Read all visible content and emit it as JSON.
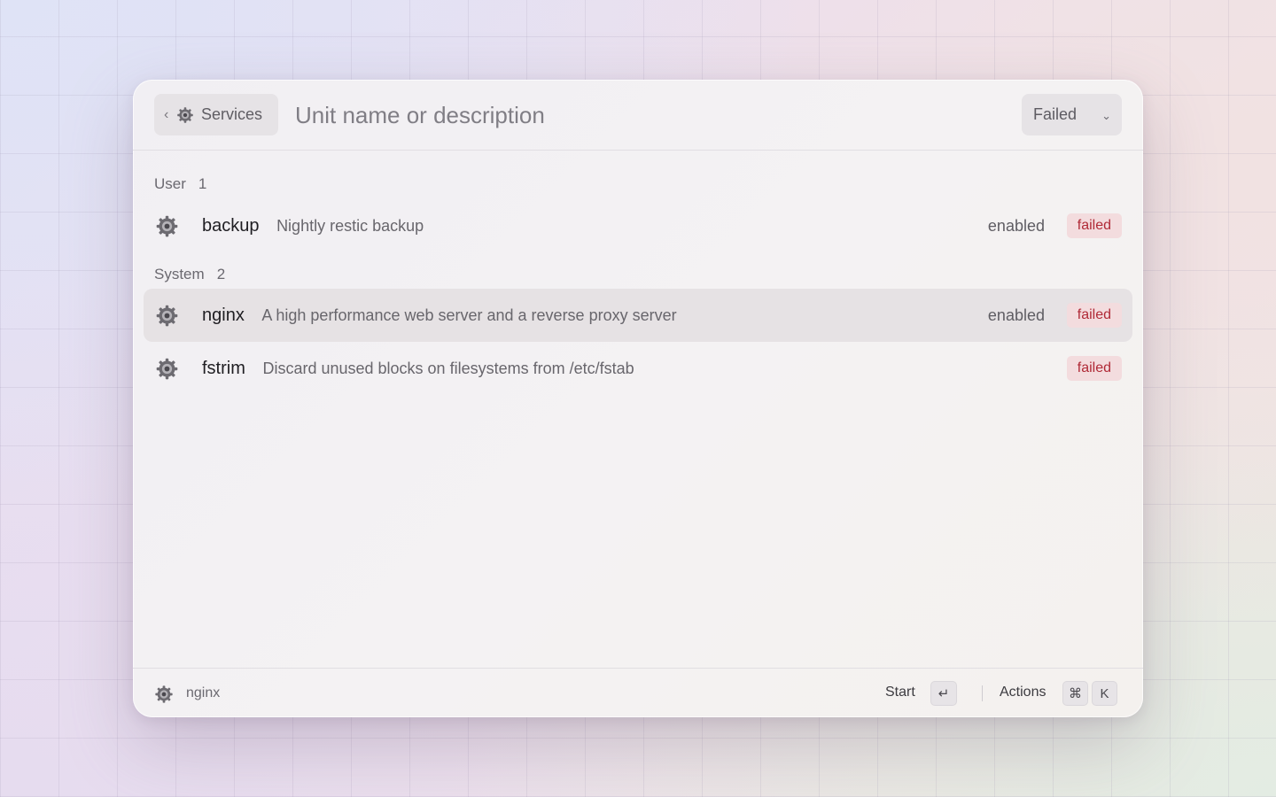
{
  "header": {
    "back_label": "Services",
    "search_placeholder": "Unit name or description",
    "filter_value": "Failed"
  },
  "sections": [
    {
      "title": "User",
      "count": "1",
      "items": [
        {
          "name": "backup",
          "description": "Nightly restic backup",
          "enabled": "enabled",
          "status": "failed"
        }
      ]
    },
    {
      "title": "System",
      "count": "2",
      "items": [
        {
          "name": "nginx",
          "description": "A high performance web server and a reverse proxy server",
          "enabled": "enabled",
          "status": "failed"
        },
        {
          "name": "fstrim",
          "description": "Discard unused blocks on filesystems from /etc/fstab",
          "enabled": "",
          "status": "failed"
        }
      ]
    }
  ],
  "footer": {
    "selected_name": "nginx",
    "primary_action": "Start",
    "primary_key": "↵",
    "actions_label": "Actions",
    "actions_key_mod": "⌘",
    "actions_key": "K"
  },
  "colors": {
    "failed_badge_bg": "#f3dcde",
    "failed_badge_text": "#b02a37",
    "selected_row_bg": "#e6e2e4"
  },
  "icons": [
    "chevron-left-icon",
    "gear-icon",
    "chevron-down-icon",
    "return-key-icon",
    "command-key-icon"
  ]
}
